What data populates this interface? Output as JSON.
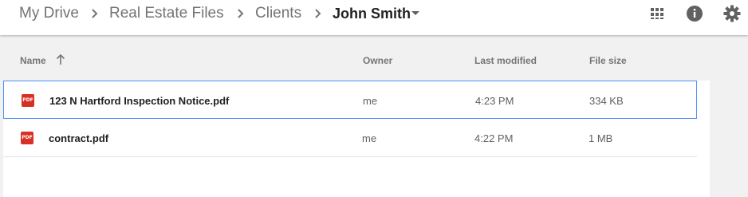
{
  "breadcrumb": {
    "items": [
      "My Drive",
      "Real Estate Files",
      "Clients"
    ],
    "current": "John Smith"
  },
  "toolbar": {
    "icons": [
      "grid-view-icon",
      "info-icon",
      "settings-gear-icon"
    ]
  },
  "table": {
    "columns": {
      "name": "Name",
      "owner": "Owner",
      "last_modified": "Last modified",
      "file_size": "File size"
    },
    "sort": "name-ascending",
    "rows": [
      {
        "icon_label": "PDF",
        "name": "123 N Hartford Inspection Notice.pdf",
        "owner": "me",
        "modified": "4:23 PM",
        "size": "334 KB",
        "selected": true
      },
      {
        "icon_label": "PDF",
        "name": "contract.pdf",
        "owner": "me",
        "modified": "4:22 PM",
        "size": "1 MB",
        "selected": false
      }
    ]
  },
  "colors": {
    "selection_border": "#4d90fe",
    "pdf_icon": "#d93025",
    "background": "#f1f1f1"
  }
}
